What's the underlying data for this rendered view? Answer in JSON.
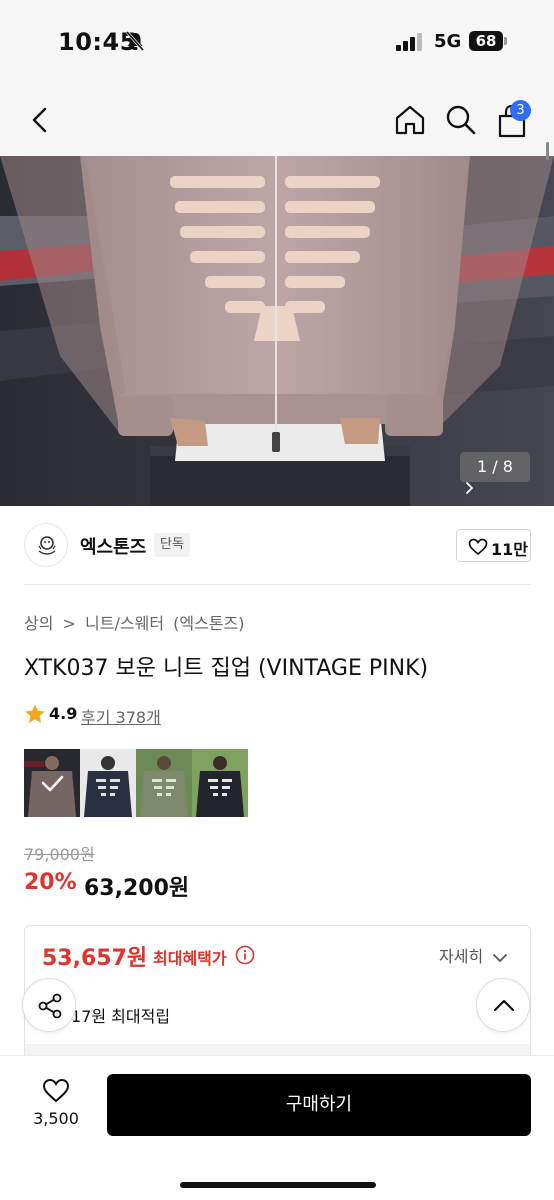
{
  "status_bar": {
    "time": "10:45",
    "network": "5G",
    "battery": "68"
  },
  "nav": {
    "cart_badge": "3"
  },
  "gallery": {
    "page_indicator": "1 / 8",
    "current": 1,
    "total": 8
  },
  "brand": {
    "name": "엑스톤즈",
    "tag": "단독",
    "likes": "11만"
  },
  "product": {
    "breadcrumb": [
      "상의",
      ">",
      "니트/스웨터",
      "(엑스톤즈)"
    ],
    "title": "XTK037 보운 니트 집업 (VINTAGE PINK)",
    "rating": "4.9",
    "review_link": "후기 378개",
    "color_thumbs": [
      "vintage-pink",
      "navy",
      "khaki",
      "black"
    ],
    "selected_thumb": 0
  },
  "price": {
    "original": "79,000원",
    "discount": "20%",
    "sale": "63,200원"
  },
  "benefit": {
    "max_price": "53,657원",
    "max_label": "최대혜택가",
    "detail_label": "자세히",
    "points_text": "17원 최대적립"
  },
  "bottom_bar": {
    "wish_count": "3,500",
    "buy_label": "구매하기"
  },
  "colors": {
    "accent_red": "#e0332d",
    "badge_blue": "#2f6df5",
    "sweater_pink": "#b59c9c"
  }
}
